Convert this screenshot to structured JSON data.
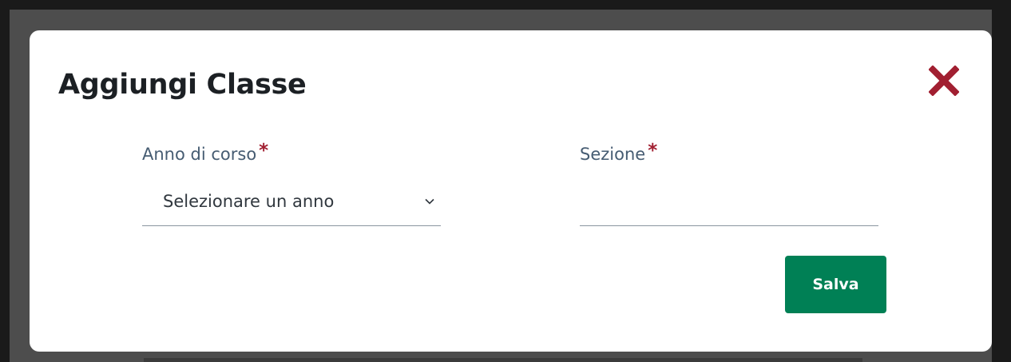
{
  "modal": {
    "title": "Aggiungi Classe",
    "close_icon": "close-icon"
  },
  "form": {
    "year": {
      "label": "Anno di corso",
      "required_mark": "*",
      "selected": "Selezionare un anno",
      "icon": "chevron-down-icon"
    },
    "section": {
      "label": "Sezione",
      "required_mark": "*",
      "value": ""
    },
    "save_label": "Salva"
  },
  "colors": {
    "accent": "#008055",
    "required": "#a11f31",
    "close": "#a11f31",
    "label": "#465c72",
    "title": "#1c2024",
    "overlay": "#4d4d4d"
  }
}
